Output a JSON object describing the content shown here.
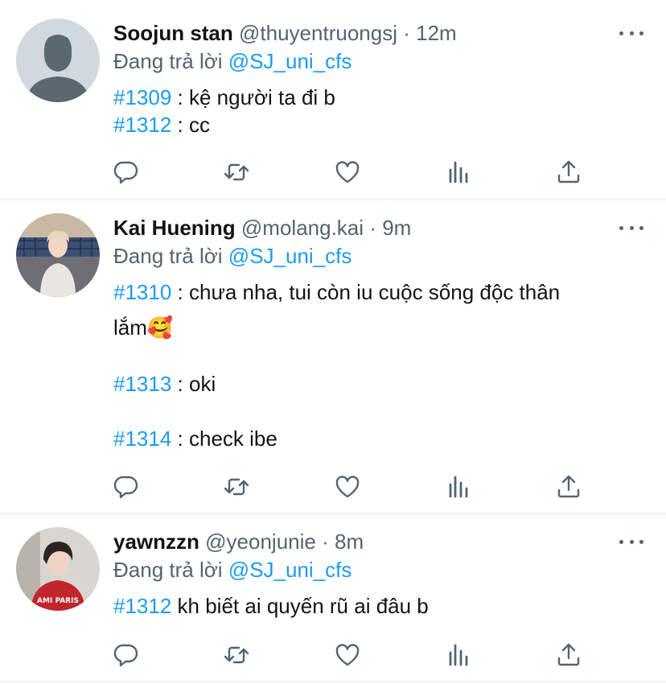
{
  "tweets": [
    {
      "name": "Soojun stan",
      "handle": "@thuyentruongsj",
      "dot": "·",
      "time": "12m",
      "reply_prefix": "Đang trả lời",
      "reply_to": "@SJ_uni_cfs",
      "avatar": "default-profile-placeholder",
      "lines": [
        {
          "tag": "#1309",
          "text": " : kệ người ta đi b"
        },
        {
          "tag": "#1312",
          "text": " : cc"
        }
      ]
    },
    {
      "name": "Kai Huening",
      "handle": "@molang.kai",
      "dot": "·",
      "time": "9m",
      "reply_prefix": "Đang trả lời",
      "reply_to": "@SJ_uni_cfs",
      "avatar": "photo-person-white-hoodie",
      "lines": [
        {
          "tag": "#1310",
          "text": " : chưa nha, tui còn iu cuộc sống độc thân"
        },
        {
          "tag": "",
          "text": "lắm🥰"
        },
        {
          "tag": "#1313",
          "text": " : oki"
        },
        {
          "tag": "#1314",
          "text": " : check ibe"
        }
      ]
    },
    {
      "name": "yawnzzn",
      "handle": "@yeonjunie",
      "dot": "·",
      "time": "8m",
      "reply_prefix": "Đang trả lời",
      "reply_to": "@SJ_uni_cfs",
      "avatar": "photo-person-red-sweatshirt",
      "lines": [
        {
          "tag": "#1312",
          "text": " kh biết ai quyến rũ ai đâu b"
        }
      ]
    }
  ],
  "action_icons": [
    "reply-icon",
    "retweet-icon",
    "like-icon",
    "analytics-icon",
    "share-icon"
  ],
  "colors": {
    "accent": "#1d9bf0",
    "secondary_text": "#536471",
    "primary_text": "#0f1419",
    "divider": "#eff3f4"
  }
}
